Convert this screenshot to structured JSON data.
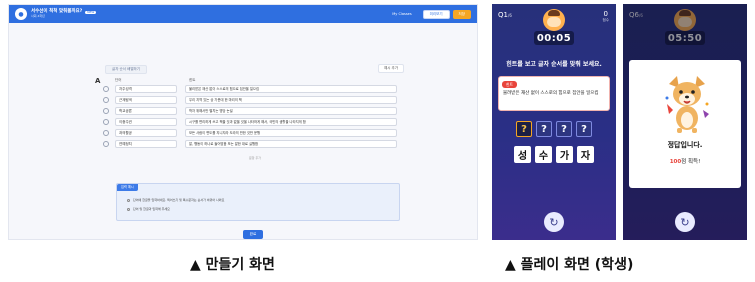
{
  "editor": {
    "header": {
      "title": "서수선이 척척 맞춰볼까요?",
      "badge": "NEW",
      "subtitle": "사회·4학년",
      "link": "My Classes",
      "preview_label": "미리보기",
      "save_label": "저장"
    },
    "tag": "글자 순서 배열하기",
    "add_label": "예시 추가",
    "column_letter": "A",
    "col_word": "단어",
    "col_hint": "힌트",
    "rows": [
      {
        "word": "자주성격",
        "hint": "불리받은 재산 없이 스스로의 힘으로 집안을 일으킴"
      },
      {
        "word": "근계탐색",
        "hint": "우리 지역 있는 상 가운데 한 마리의 책"
      },
      {
        "word": "학교공론",
        "hint": "학자 위해서만 펼치는 명당 논설"
      },
      {
        "word": "이중주권",
        "hint": "시구를 편리하게 쓰고 책을 것과 없을 것을 나타하게 해서, 국민의 생활을 나타지게 함"
      },
      {
        "word": "과의활공",
        "hint": "모든 사람이 편도를 지니지라 도라의 만한 것만 운행"
      },
      {
        "word": "연예정치",
        "hint": "말, 행동이 하나로 들어맞음 또는 말한 대로 실행함"
      }
    ],
    "more_label": "문항 추가",
    "guide": {
      "title": "입력 예시",
      "lines": [
        "단어에 한글을 입력하세요. 띄어쓰기 및 특수문자는 순서가 바뀌어 나와요",
        "단어 및 한글과 입력해 주세요"
      ]
    },
    "done_label": "완료"
  },
  "play1": {
    "question_no": "Q1",
    "question_unit": "/6",
    "score": "0",
    "score_label": "점수",
    "timer": "00:05",
    "instruction": "힌트를 보고 글자 순서를 맞춰 보세요.",
    "hint_tag": "힌트",
    "hint_text": "물려받은 재산 없이 스스로의 힘으로 집안을 일으킴",
    "blanks": [
      "?",
      "?",
      "?",
      "?"
    ],
    "letters": [
      "성",
      "수",
      "가",
      "자"
    ],
    "reset_icon": "↻"
  },
  "play2": {
    "question_no": "Q6",
    "question_unit": "/6",
    "timer": "05:50",
    "result": "정답입니다.",
    "points_value": "100",
    "points_suffix": "점 획득!",
    "reset_icon": "↻"
  },
  "captions": {
    "left": "▲ 만들기 화면",
    "right": "▲ 플레이 화면 (학생)"
  },
  "colors": {
    "primary": "#2f6fe0",
    "accent": "#f5a623",
    "play_bg": "#27307a",
    "hint_red": "#e8453c"
  }
}
